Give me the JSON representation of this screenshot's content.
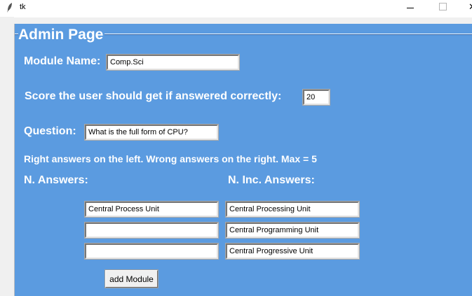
{
  "window": {
    "title": "tk",
    "close_glyph": "✕"
  },
  "frame": {
    "title": "Admin Page",
    "background": "#5b9be0"
  },
  "module": {
    "label": "Module Name:",
    "value": "Comp.Sci"
  },
  "score": {
    "label": "Score the user should get if  answered correctly:",
    "value": "20"
  },
  "question": {
    "label": "Question:",
    "value": "What is the full form of CPU?"
  },
  "instructions": "Right answers on the left. Wrong answers on the right. Max = 5",
  "answers": {
    "correct_label": "N. Answers:",
    "incorrect_label": "N. Inc. Answers:",
    "correct": [
      "Central Process Unit",
      "",
      ""
    ],
    "incorrect": [
      "Central Processing Unit",
      "Central Programming Unit",
      "Central Progressive Unit"
    ]
  },
  "add_button_label": "add Module",
  "icons": {
    "app": "feather-icon",
    "minimize": "minimize-icon",
    "maximize": "maximize-icon",
    "close": "close-icon"
  }
}
